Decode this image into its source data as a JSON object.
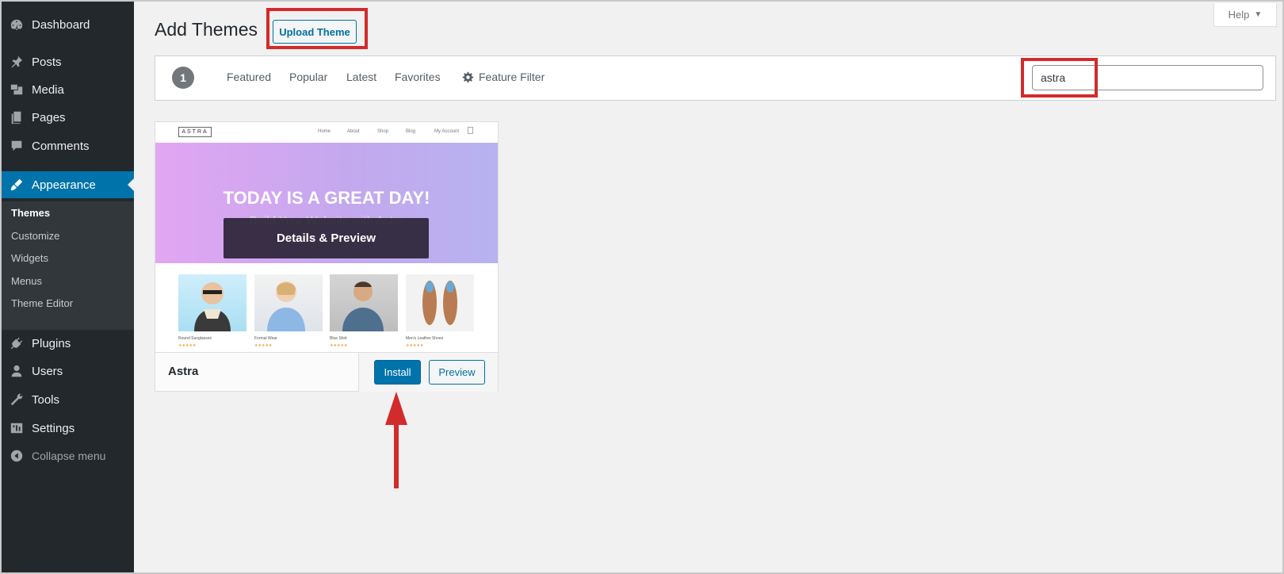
{
  "sidebar": {
    "items": [
      {
        "label": "Dashboard",
        "icon": "dashboard-icon"
      },
      {
        "label": "Posts",
        "icon": "pin-icon"
      },
      {
        "label": "Media",
        "icon": "media-icon"
      },
      {
        "label": "Pages",
        "icon": "pages-icon"
      },
      {
        "label": "Comments",
        "icon": "comment-icon"
      },
      {
        "label": "Appearance",
        "icon": "brush-icon",
        "active": true
      },
      {
        "label": "Plugins",
        "icon": "plugin-icon"
      },
      {
        "label": "Users",
        "icon": "user-icon"
      },
      {
        "label": "Tools",
        "icon": "wrench-icon"
      },
      {
        "label": "Settings",
        "icon": "settings-icon"
      },
      {
        "label": "Collapse menu",
        "icon": "collapse-icon"
      }
    ],
    "submenu": [
      {
        "label": "Themes",
        "current": true
      },
      {
        "label": "Customize"
      },
      {
        "label": "Widgets"
      },
      {
        "label": "Menus"
      },
      {
        "label": "Theme Editor"
      }
    ]
  },
  "header": {
    "title": "Add Themes",
    "upload_label": "Upload Theme",
    "help_label": "Help"
  },
  "filter": {
    "count": "1",
    "links": [
      "Featured",
      "Popular",
      "Latest",
      "Favorites"
    ],
    "feature_filter_label": "Feature Filter",
    "search_value": "astra"
  },
  "theme": {
    "name": "Astra",
    "install_label": "Install",
    "preview_label": "Preview",
    "details_label": "Details & Preview",
    "screenshot": {
      "logo": "ASTRA",
      "nav": [
        "Home",
        "About",
        "Shop",
        "Blog",
        "My Account"
      ],
      "hero_title": "TODAY IS A GREAT DAY!",
      "hero_subtitle": "Build Your Website with Astra",
      "products": [
        "Round Sunglasses",
        "Formal Wear",
        "Blue Shirt",
        "Men's Leather Shoes"
      ],
      "stars": "★★★★★"
    }
  },
  "colors": {
    "sidebar_bg": "#23282d",
    "active_blue": "#0073aa",
    "annotation_red": "#d22b2b"
  }
}
